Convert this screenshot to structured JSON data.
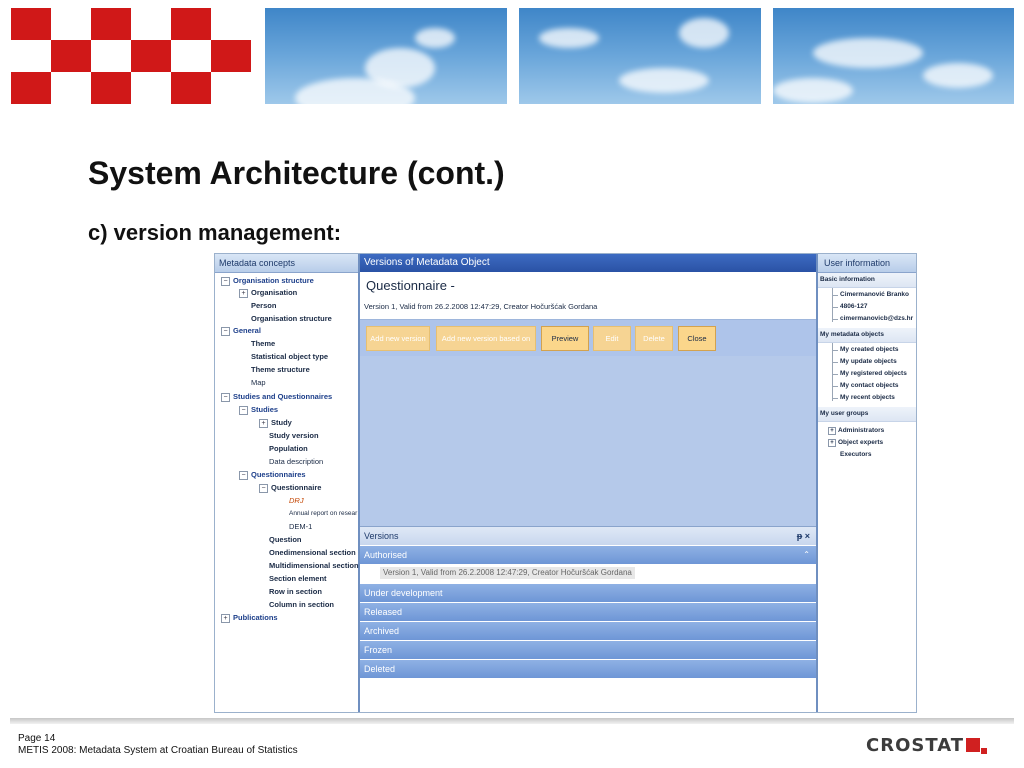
{
  "slide": {
    "title": "System Architecture (cont.)",
    "subtitle": "c) version management:",
    "page_label": "Page 14",
    "footer_text": "METIS 2008: Metadata System at Croatian Bureau of Statistics",
    "logo_text": "CROSTAT"
  },
  "left_panel": {
    "header": "Metadata concepts",
    "tree": [
      {
        "label": "Organisation structure",
        "toggle": "⊟"
      },
      {
        "label": "Organisation",
        "toggle": "⊞"
      },
      {
        "label": "Person"
      },
      {
        "label": "Organisation structure"
      },
      {
        "label": "General",
        "toggle": "⊟"
      },
      {
        "label": "Theme"
      },
      {
        "label": "Statistical object type"
      },
      {
        "label": "Theme structure"
      },
      {
        "label": "Map"
      },
      {
        "label": "Studies and Questionnaires",
        "toggle": "⊟"
      },
      {
        "label": "Studies",
        "toggle": "⊟"
      },
      {
        "label": "Study",
        "toggle": "⊞"
      },
      {
        "label": "Study version"
      },
      {
        "label": "Population"
      },
      {
        "label": "Data description"
      },
      {
        "label": "Questionnaires",
        "toggle": "⊟"
      },
      {
        "label": "Questionnaire",
        "toggle": "⊟"
      },
      {
        "label": "DRJ"
      },
      {
        "label": "Annual report on resear"
      },
      {
        "label": "DEM-1"
      },
      {
        "label": "Question"
      },
      {
        "label": "Onedimensional section"
      },
      {
        "label": "Multidimensional section"
      },
      {
        "label": "Section element"
      },
      {
        "label": "Row in section"
      },
      {
        "label": "Column in section"
      },
      {
        "label": "Publications",
        "toggle": "⊞"
      }
    ]
  },
  "main_panel": {
    "header": "Versions of Metadata Object",
    "object_title": "Questionnaire -",
    "version_info": "Version 1, Valid from 26.2.2008 12:47:29, Creator Hočuršćak Gordana",
    "buttons": {
      "add_new_version": "Add new version",
      "add_based_on": "Add new version based on",
      "preview": "Preview",
      "edit": "Edit",
      "delete": "Delete",
      "close": "Close"
    },
    "versions_pane": {
      "header": "Versions",
      "pin_icons": "ᵽ ×",
      "groups": {
        "authorised": "Authorised",
        "under_development": "Under development",
        "released": "Released",
        "archived": "Archived",
        "frozen": "Frozen",
        "deleted": "Deleted"
      },
      "authorised_item": "Version 1, Valid from 26.2.2008 12:47:29, Creator Hočuršćak Gordana",
      "collapse_glyph": "⌃"
    }
  },
  "right_panel": {
    "header": "User information",
    "basic_info": {
      "title": "Basic information",
      "name": "Cimermanović Branko",
      "phone": "4806-127",
      "email": "cimermanovicb@dzs.hr"
    },
    "my_metadata": {
      "title": "My metadata objects",
      "items": [
        "My created objects",
        "My update objects",
        "My registered objects",
        "My contact objects",
        "My recent objects"
      ]
    },
    "my_groups": {
      "title": "My user groups",
      "items": [
        "Administrators",
        "Object experts",
        "Executors"
      ]
    }
  },
  "colors": {
    "accent_red": "#d01818",
    "header_blue": "#2a52a5",
    "button_orange": "#fbd68b"
  }
}
